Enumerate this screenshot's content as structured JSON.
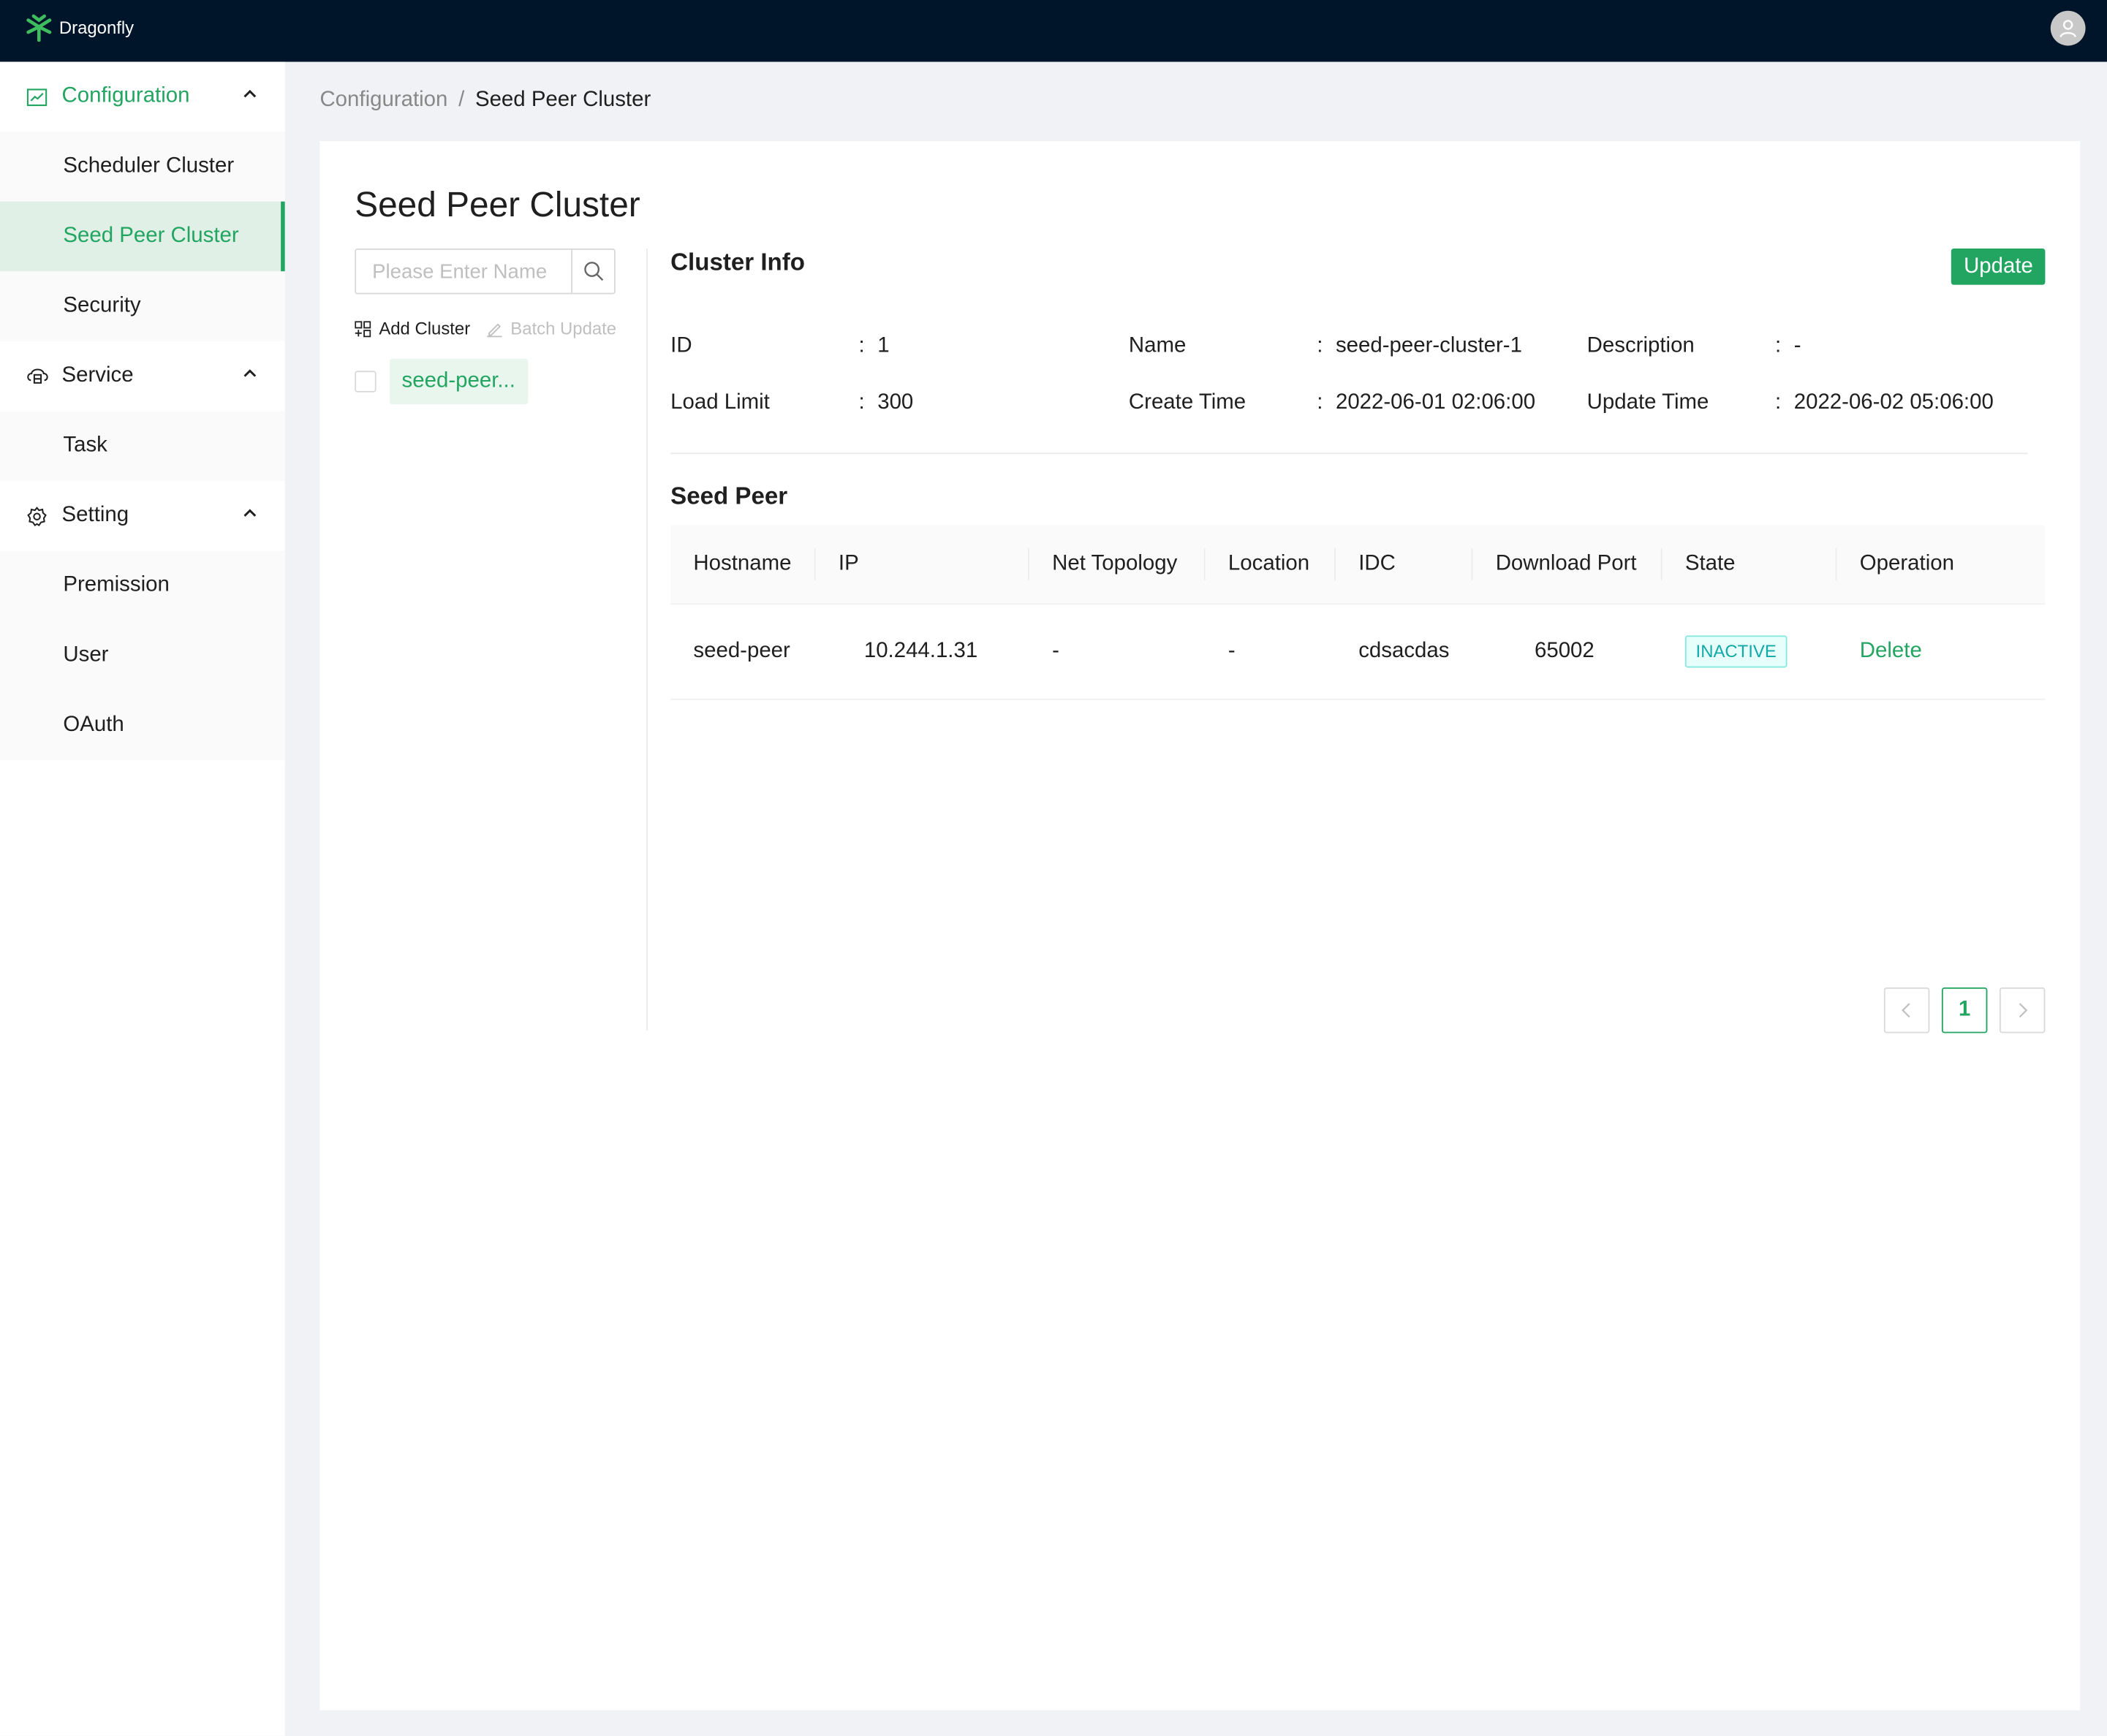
{
  "app": {
    "name": "Dragonfly"
  },
  "sidebar": {
    "groups": [
      {
        "label": "Configuration",
        "icon": "chart-line-icon",
        "items": [
          "Scheduler Cluster",
          "Seed Peer Cluster",
          "Security"
        ]
      },
      {
        "label": "Service",
        "icon": "cloud-server-icon",
        "items": [
          "Task"
        ]
      },
      {
        "label": "Setting",
        "icon": "gear-icon",
        "items": [
          "Premission",
          "User",
          "OAuth"
        ]
      }
    ],
    "active_item": "Seed Peer Cluster"
  },
  "breadcrumb": {
    "parent": "Configuration",
    "separator": "/",
    "current": "Seed Peer Cluster"
  },
  "page": {
    "title": "Seed Peer Cluster",
    "search_placeholder": "Please Enter Name",
    "add_cluster": "Add Cluster",
    "batch_update": "Batch Update",
    "clusters": [
      "seed-peer..."
    ]
  },
  "cluster_info": {
    "title": "Cluster Info",
    "update_label": "Update",
    "id_label": "ID",
    "id": "1",
    "name_label": "Name",
    "name": "seed-peer-cluster-1",
    "description_label": "Description",
    "description": "-",
    "load_limit_label": "Load Limit",
    "load_limit": "300",
    "create_time_label": "Create Time",
    "create_time": "2022-06-01 02:06:00",
    "update_time_label": "Update Time",
    "update_time": "2022-06-02 05:06:00",
    "colon": ":"
  },
  "seed_peer": {
    "title": "Seed Peer",
    "columns": [
      "Hostname",
      "IP",
      "Net Topology",
      "Location",
      "IDC",
      "Download Port",
      "State",
      "Operation"
    ],
    "rows": [
      {
        "hostname": "seed-peer",
        "ip": "10.244.1.31",
        "net_topology": "-",
        "location": "-",
        "idc": "cdsacdas",
        "download_port": "65002",
        "state": "INACTIVE",
        "operation": "Delete"
      }
    ]
  },
  "pagination": {
    "current": "1",
    "prev": "<",
    "next": ">"
  },
  "colors": {
    "accent": "#23a562",
    "topbar": "#00152a",
    "inactive_tag": "#13a8a8"
  }
}
